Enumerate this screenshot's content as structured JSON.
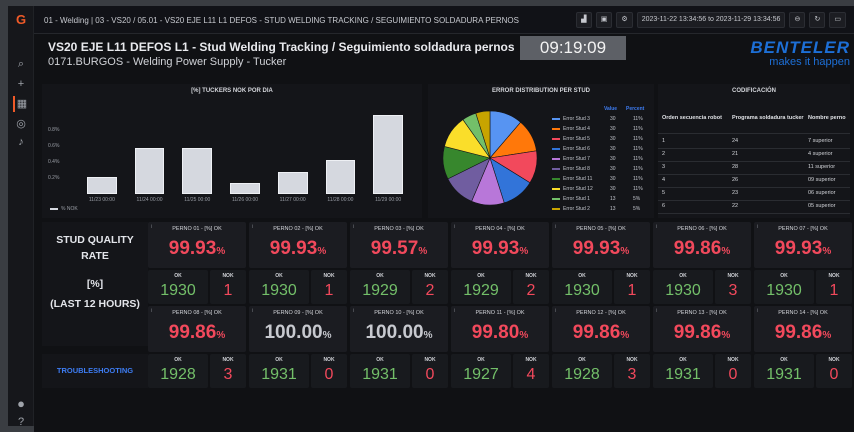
{
  "app": {
    "logo": "G",
    "breadcrumb": "01 - Welding | 03 - VS20 / 05.01 - VS20 EJE L11 L1 DEFOS - STUD WELDING TRACKING / SEGUIMIENTO SOLDADURA PERNOS",
    "time_range": "2023-11-22 13:34:56 to 2023-11-29 13:34:56",
    "zoom_out": "⊖",
    "refresh": "↻"
  },
  "header": {
    "title": "VS20 EJE L11 DEFOS L1 - Stud Welding Tracking / Seguimiento soldadura pernos",
    "subtitle": "0171.BURGOS - Welding Power Supply - Tucker",
    "clock": "09:19:09",
    "brand": "BENTELER",
    "brand_tagline": "makes it happen"
  },
  "chart_data": [
    {
      "type": "bar",
      "title": "[%] TUCKERS NOK POR DIA",
      "categories": [
        "11/23 00:00",
        "11/24 00:00",
        "11/25 00:00",
        "11/26 00:00",
        "11/27 00:00",
        "11/28 00:00",
        "11/29 00:00"
      ],
      "series": [
        {
          "name": "% NOK",
          "values": [
            0.21,
            0.57,
            0.57,
            0.14,
            0.28,
            0.42,
            0.99
          ]
        }
      ],
      "yticks": [
        "0.2%",
        "0.4%",
        "0.6%",
        "0.8%"
      ],
      "ylim": [
        0,
        1.1
      ],
      "color": "#d5d8df",
      "legend_placement": "bottom-left"
    },
    {
      "type": "pie",
      "title": "ERROR DISTRIBUTION PER STUD",
      "legend_headers": [
        "Value",
        "Percent"
      ],
      "slices": [
        {
          "name": "Error Stud 3",
          "value": 30,
          "percent": "11%",
          "color": "#5794f2"
        },
        {
          "name": "Error Stud 4",
          "value": 30,
          "percent": "11%",
          "color": "#ff780a"
        },
        {
          "name": "Error Stud 5",
          "value": 30,
          "percent": "11%",
          "color": "#f2495c"
        },
        {
          "name": "Error Stud 6",
          "value": 30,
          "percent": "11%",
          "color": "#3274d9"
        },
        {
          "name": "Error Stud 7",
          "value": 30,
          "percent": "11%",
          "color": "#b877d9"
        },
        {
          "name": "Error Stud 8",
          "value": 30,
          "percent": "11%",
          "color": "#705da0"
        },
        {
          "name": "Error Stud 11",
          "value": 30,
          "percent": "11%",
          "color": "#37872d"
        },
        {
          "name": "Error Stud 12",
          "value": 30,
          "percent": "11%",
          "color": "#fade2a"
        },
        {
          "name": "Error Stud 1",
          "value": 13,
          "percent": "5%",
          "color": "#73bf69"
        },
        {
          "name": "Error Stud 2",
          "value": 13,
          "percent": "5%",
          "color": "#c8a400"
        }
      ]
    }
  ],
  "codificacion": {
    "title": "CODIFICACIÓN",
    "headers": [
      "Orden secuencia robot",
      "Programa soldadura tucker",
      "Nombre perno"
    ],
    "rows": [
      [
        "1",
        "24",
        "7 superior"
      ],
      [
        "2",
        "21",
        "4 superior"
      ],
      [
        "3",
        "28",
        "11 superior"
      ],
      [
        "4",
        "26",
        "09 superior"
      ],
      [
        "5",
        "23",
        "06 superior"
      ],
      [
        "6",
        "22",
        "05 superior"
      ]
    ]
  },
  "quality": {
    "line1": "STUD QUALITY",
    "line2": "RATE",
    "line3": "[%]",
    "line4": "(LAST 12 HOURS)",
    "troubleshooting": "TROUBLESHOOTING",
    "ok_label": "OK",
    "nok_label": "NOK"
  },
  "perno_row1": [
    {
      "title": "PERNO 01 - [%] OK",
      "value": "99.93",
      "ok": "1930",
      "nok": "1",
      "color": "#f2495c"
    },
    {
      "title": "PERNO 02 - [%] OK",
      "value": "99.93",
      "ok": "1930",
      "nok": "1",
      "color": "#f2495c"
    },
    {
      "title": "PERNO 03 - [%] OK",
      "value": "99.57",
      "ok": "1929",
      "nok": "2",
      "color": "#f2495c"
    },
    {
      "title": "PERNO 04 - [%] OK",
      "value": "99.93",
      "ok": "1929",
      "nok": "2",
      "color": "#f2495c"
    },
    {
      "title": "PERNO 05 - [%] OK",
      "value": "99.93",
      "ok": "1930",
      "nok": "1",
      "color": "#f2495c"
    },
    {
      "title": "PERNO 06 - [%] OK",
      "value": "99.86",
      "ok": "1930",
      "nok": "3",
      "color": "#f2495c"
    },
    {
      "title": "PERNO 07 - [%] OK",
      "value": "99.93",
      "ok": "1930",
      "nok": "1",
      "color": "#f2495c"
    }
  ],
  "perno_row2": [
    {
      "title": "PERNO 08 - [%] OK",
      "value": "99.86",
      "ok": "1928",
      "nok": "3",
      "color": "#f2495c"
    },
    {
      "title": "PERNO 09 - [%] OK",
      "value": "100.00",
      "ok": "1931",
      "nok": "0",
      "color": "#c7c9cf"
    },
    {
      "title": "PERNO 10 - [%] OK",
      "value": "100.00",
      "ok": "1931",
      "nok": "0",
      "color": "#c7c9cf"
    },
    {
      "title": "PERNO 11 - [%] OK",
      "value": "99.80",
      "ok": "1927",
      "nok": "4",
      "color": "#f2495c"
    },
    {
      "title": "PERNO 12 - [%] OK",
      "value": "99.86",
      "ok": "1928",
      "nok": "3",
      "color": "#f2495c"
    },
    {
      "title": "PERNO 13 - [%] OK",
      "value": "99.86",
      "ok": "1931",
      "nok": "0",
      "color": "#f2495c"
    },
    {
      "title": "PERNO 14 - [%] OK",
      "value": "99.86",
      "ok": "1931",
      "nok": "0",
      "color": "#f2495c"
    }
  ]
}
